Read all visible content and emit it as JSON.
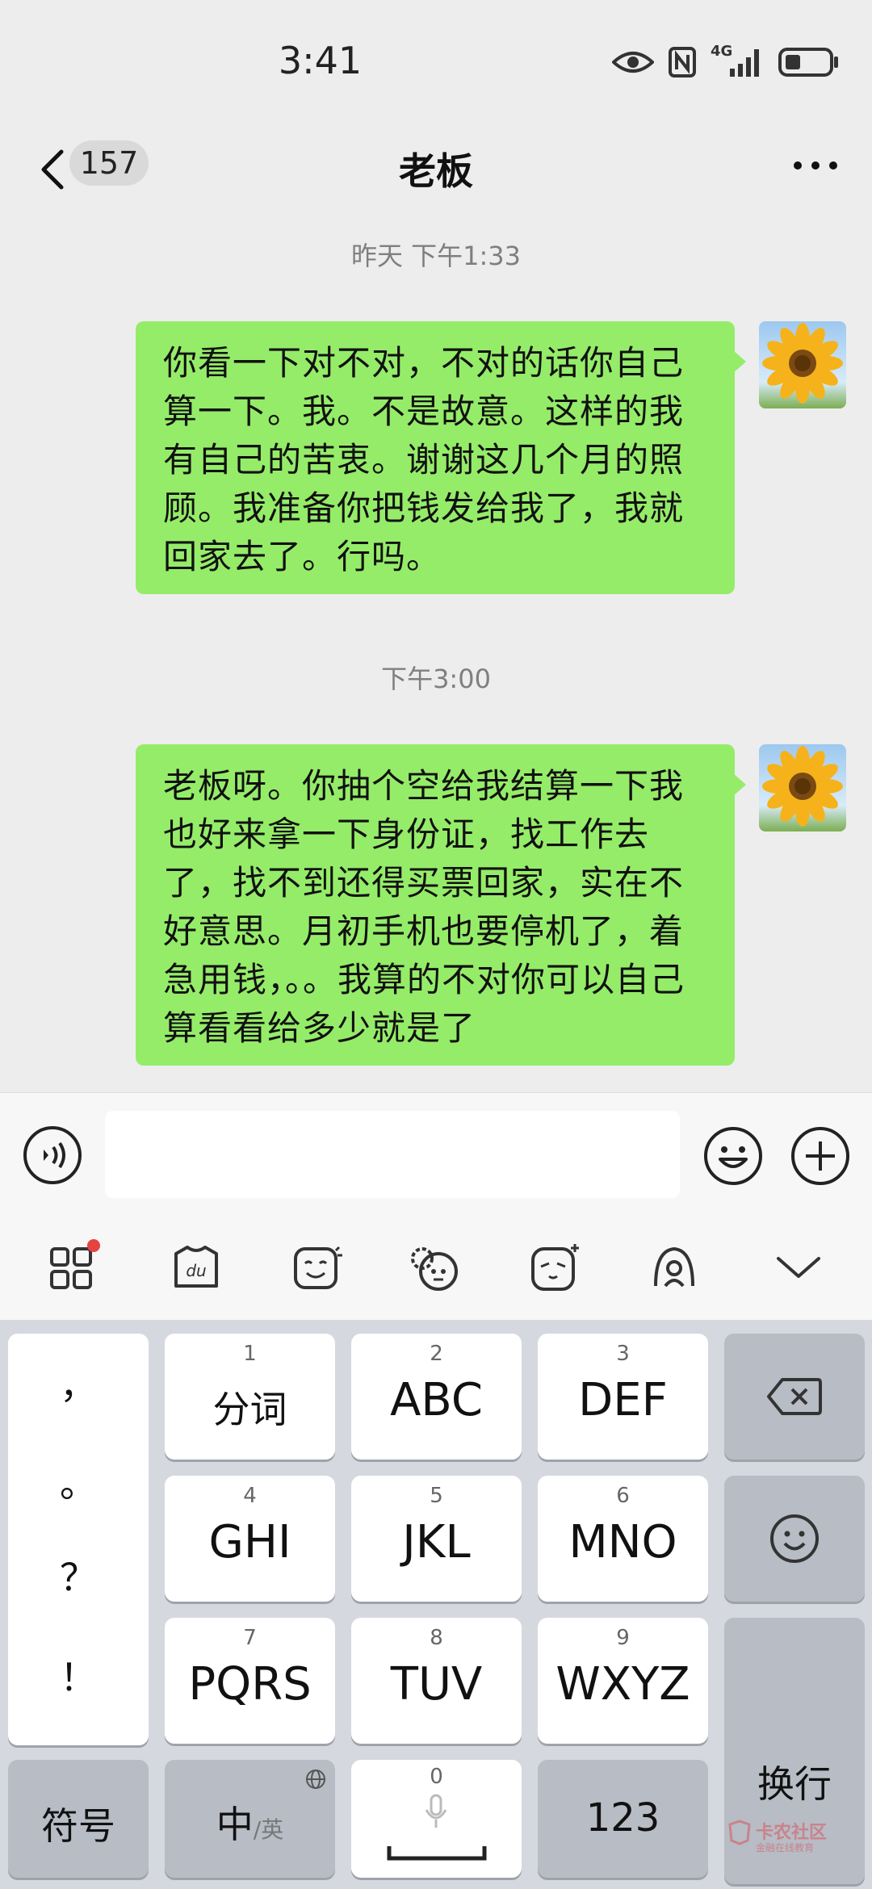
{
  "status_bar": {
    "time": "3:41",
    "network": "4G"
  },
  "nav": {
    "unread_count": "157",
    "title": "老板"
  },
  "messages": [
    {
      "timestamp": "昨天 下午1:33",
      "text": "你看一下对不对，不对的话你自己算一下。我。不是故意。这样的我有自己的苦衷。谢谢这几个月的照顾。我准备你把钱发给我了，我就回家去了。行吗。"
    },
    {
      "timestamp": "下午3:00",
      "text": "老板呀。你抽个空给我结算一下我也好来拿一下身份证，找工作去了，找不到还得买票回家，实在不好意思。月初手机也要停机了，着急用钱，。。我算的不对你可以自己算看看给多少就是了"
    }
  ],
  "input": {
    "value": ""
  },
  "toolbar": {
    "items": [
      "apps-icon",
      "du-skin-icon",
      "sticker-icon",
      "emoji-face-icon",
      "avatar-icon",
      "keyboard-switch-icon",
      "collapse-icon"
    ]
  },
  "keyboard": {
    "punctuation": [
      "，",
      "。",
      "？",
      "！"
    ],
    "keys": [
      {
        "num": "1",
        "label": "分词"
      },
      {
        "num": "2",
        "label": "ABC"
      },
      {
        "num": "3",
        "label": "DEF"
      },
      {
        "num": "4",
        "label": "GHI"
      },
      {
        "num": "5",
        "label": "JKL"
      },
      {
        "num": "6",
        "label": "MNO"
      },
      {
        "num": "7",
        "label": "PQRS"
      },
      {
        "num": "8",
        "label": "TUV"
      },
      {
        "num": "9",
        "label": "WXYZ"
      },
      {
        "num": "0",
        "label": ""
      }
    ],
    "symbol_key": "符号",
    "lang_key_main": "中",
    "lang_key_sub": "/英",
    "number_key": "123",
    "enter_key": "换行"
  },
  "watermark": {
    "text": "卡农社区",
    "sub": "金融在线教育"
  },
  "colors": {
    "bubble": "#95ec69",
    "background": "#ededed",
    "keyboard": "#d5d8de",
    "badge_dot": "#e64340"
  }
}
